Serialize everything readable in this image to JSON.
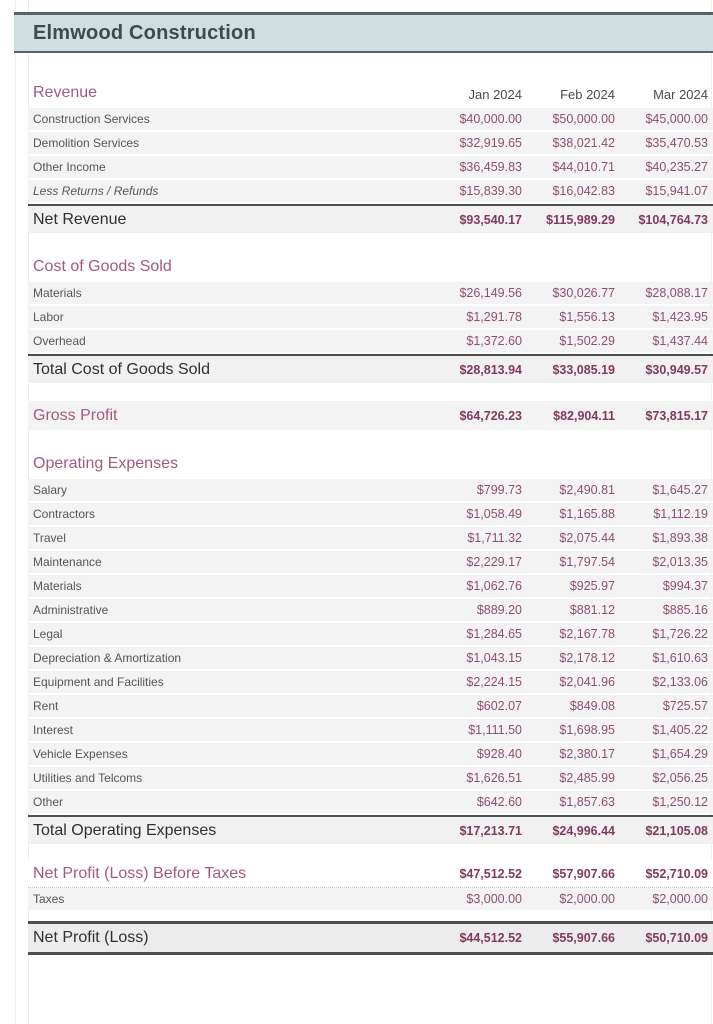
{
  "title": "Elmwood Construction",
  "columns": [
    "Jan 2024",
    "Feb 2024",
    "Mar 2024"
  ],
  "revenue": {
    "heading": "Revenue",
    "rows": [
      {
        "label": "Construction Services",
        "v": [
          "$40,000.00",
          "$50,000.00",
          "$45,000.00"
        ]
      },
      {
        "label": "Demolition Services",
        "v": [
          "$32,919.65",
          "$38,021.42",
          "$35,470.53"
        ]
      },
      {
        "label": "Other Income",
        "v": [
          "$36,459.83",
          "$44,010.71",
          "$40,235.27"
        ]
      },
      {
        "label": "Less Returns / Refunds",
        "v": [
          "$15,839.30",
          "$16,042.83",
          "$15,941.07"
        ]
      }
    ],
    "total": {
      "label": "Net Revenue",
      "v": [
        "$93,540.17",
        "$115,989.29",
        "$104,764.73"
      ]
    }
  },
  "cogs": {
    "heading": "Cost of Goods Sold",
    "rows": [
      {
        "label": "Materials",
        "v": [
          "$26,149.56",
          "$30,026.77",
          "$28,088.17"
        ]
      },
      {
        "label": "Labor",
        "v": [
          "$1,291.78",
          "$1,556.13",
          "$1,423.95"
        ]
      },
      {
        "label": "Overhead",
        "v": [
          "$1,372.60",
          "$1,502.29",
          "$1,437.44"
        ]
      }
    ],
    "total": {
      "label": "Total Cost of Goods Sold",
      "v": [
        "$28,813.94",
        "$33,085.19",
        "$30,949.57"
      ]
    }
  },
  "gross_profit": {
    "label": "Gross Profit",
    "v": [
      "$64,726.23",
      "$82,904.11",
      "$73,815.17"
    ]
  },
  "opex": {
    "heading": "Operating Expenses",
    "rows": [
      {
        "label": "Salary",
        "v": [
          "$799.73",
          "$2,490.81",
          "$1,645.27"
        ]
      },
      {
        "label": "Contractors",
        "v": [
          "$1,058.49",
          "$1,165.88",
          "$1,112.19"
        ]
      },
      {
        "label": "Travel",
        "v": [
          "$1,711.32",
          "$2,075.44",
          "$1,893.38"
        ]
      },
      {
        "label": "Maintenance",
        "v": [
          "$2,229.17",
          "$1,797.54",
          "$2,013.35"
        ]
      },
      {
        "label": "Materials",
        "v": [
          "$1,062.76",
          "$925.97",
          "$994.37"
        ]
      },
      {
        "label": "Administrative",
        "v": [
          "$889.20",
          "$881.12",
          "$885.16"
        ]
      },
      {
        "label": "Legal",
        "v": [
          "$1,284.65",
          "$2,167.78",
          "$1,726.22"
        ]
      },
      {
        "label": "Depreciation & Amortization",
        "v": [
          "$1,043.15",
          "$2,178.12",
          "$1,610.63"
        ]
      },
      {
        "label": "Equipment and Facilities",
        "v": [
          "$2,224.15",
          "$2,041.96",
          "$2,133.06"
        ]
      },
      {
        "label": "Rent",
        "v": [
          "$602.07",
          "$849.08",
          "$725.57"
        ]
      },
      {
        "label": "Interest",
        "v": [
          "$1,111.50",
          "$1,698.95",
          "$1,405.22"
        ]
      },
      {
        "label": "Vehicle Expenses",
        "v": [
          "$928.40",
          "$2,380.17",
          "$1,654.29"
        ]
      },
      {
        "label": "Utilities and Telcoms",
        "v": [
          "$1,626.51",
          "$2,485.99",
          "$2,056.25"
        ]
      },
      {
        "label": "Other",
        "v": [
          "$642.60",
          "$1,857.63",
          "$1,250.12"
        ]
      }
    ],
    "total": {
      "label": "Total Operating Expenses",
      "v": [
        "$17,213.71",
        "$24,996.44",
        "$21,105.08"
      ]
    }
  },
  "npbt": {
    "label": "Net Profit (Loss) Before Taxes",
    "v": [
      "$47,512.52",
      "$57,907.66",
      "$52,710.09"
    ]
  },
  "taxes": {
    "label": "Taxes",
    "v": [
      "$3,000.00",
      "$2,000.00",
      "$2,000.00"
    ]
  },
  "net_profit": {
    "label": "Net Profit (Loss)",
    "v": [
      "$44,512.52",
      "$55,907.66",
      "$50,710.09"
    ]
  }
}
